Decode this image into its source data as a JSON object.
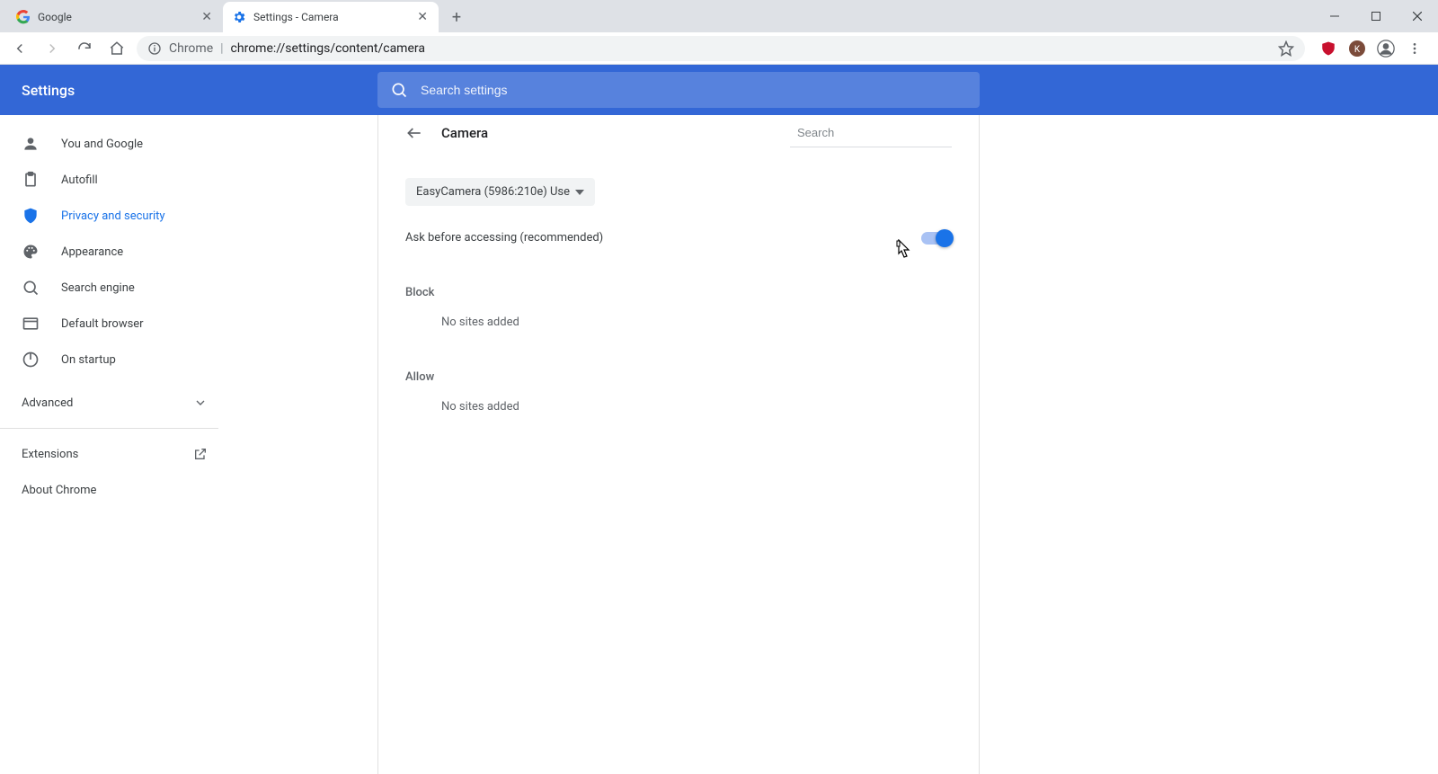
{
  "browser": {
    "tabs": [
      {
        "title": "Google",
        "favicon": "google",
        "active": false
      },
      {
        "title": "Settings - Camera",
        "favicon": "gear",
        "active": true
      }
    ],
    "omnibox": {
      "origin": "Chrome",
      "path": "chrome://settings/content/camera"
    }
  },
  "app": {
    "title": "Settings",
    "search_placeholder": "Search settings"
  },
  "sidebar": {
    "items": [
      {
        "icon": "person",
        "label": "You and Google"
      },
      {
        "icon": "clipboard",
        "label": "Autofill"
      },
      {
        "icon": "shield",
        "label": "Privacy and security",
        "selected": true
      },
      {
        "icon": "palette",
        "label": "Appearance"
      },
      {
        "icon": "search",
        "label": "Search engine"
      },
      {
        "icon": "browser",
        "label": "Default browser"
      },
      {
        "icon": "power",
        "label": "On startup"
      }
    ],
    "advanced_label": "Advanced",
    "links": [
      {
        "label": "Extensions",
        "external": true
      },
      {
        "label": "About Chrome",
        "external": false
      }
    ]
  },
  "page": {
    "title": "Camera",
    "search_placeholder": "Search",
    "camera_select": "EasyCamera (5986:210e) Use",
    "toggle_label": "Ask before accessing (recommended)",
    "toggle_on": true,
    "sections": {
      "block": {
        "label": "Block",
        "empty_text": "No sites added"
      },
      "allow": {
        "label": "Allow",
        "empty_text": "No sites added"
      }
    }
  }
}
